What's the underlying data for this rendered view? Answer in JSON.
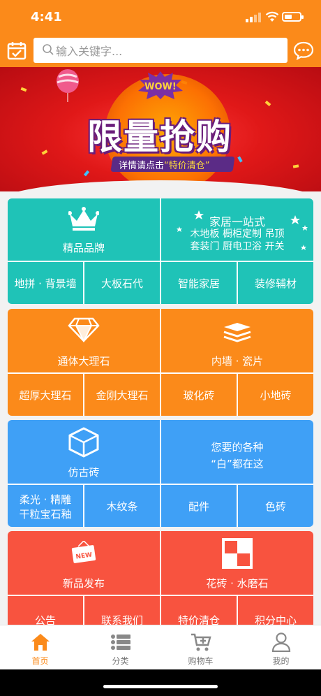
{
  "status_bar": {
    "time": "4:41"
  },
  "header": {
    "search_placeholder": "输入关键字...",
    "accent_color": "#fb8a1a"
  },
  "banner": {
    "badge": "WOW!",
    "title": "限量抢购",
    "subtitle_prefix": "详情请点击",
    "subtitle_highlight": "“特价清仓”"
  },
  "sections": [
    {
      "color": "#1fc3b7",
      "feature_label": "精品品牌",
      "feature_icon": "crown-icon",
      "promo_title": "家居一站式",
      "promo_lines": [
        "木地板 橱柜定制 吊顶",
        "套装门 厨电卫浴 开关"
      ],
      "items": [
        "地拼 · 背景墙",
        "大板石代",
        "智能家居",
        "装修辅材"
      ]
    },
    {
      "color": "#fb8a1a",
      "feature_label": "通体大理石",
      "feature_icon": "diamond-icon",
      "right_label": "内墙 · 瓷片",
      "right_icon": "layers-icon",
      "items": [
        "超厚大理石",
        "金刚大理石",
        "玻化砖",
        "小地砖"
      ]
    },
    {
      "color": "#3fa0f6",
      "feature_label": "仿古砖",
      "feature_icon": "cube-icon",
      "promo_lines": [
        "您要的各种",
        "“白”都在这"
      ],
      "items": [
        "柔光 · 精雕\n干粒宝石釉",
        "木纹条",
        "配件",
        "色砖"
      ]
    },
    {
      "color": "#f8533f",
      "feature_label": "新品发布",
      "feature_icon": "new-tag-icon",
      "new_tag": "NEW",
      "right_label": "花砖 · 水磨石",
      "right_icon": "checker-tile-icon",
      "items": [
        "公告",
        "联系我们",
        "特价清仓",
        "积分中心"
      ]
    }
  ],
  "tabbar": [
    {
      "label": "首页",
      "icon": "home-icon",
      "active": true
    },
    {
      "label": "分类",
      "icon": "list-icon",
      "active": false
    },
    {
      "label": "购物车",
      "icon": "cart-icon",
      "active": false
    },
    {
      "label": "我的",
      "icon": "user-icon",
      "active": false
    }
  ]
}
